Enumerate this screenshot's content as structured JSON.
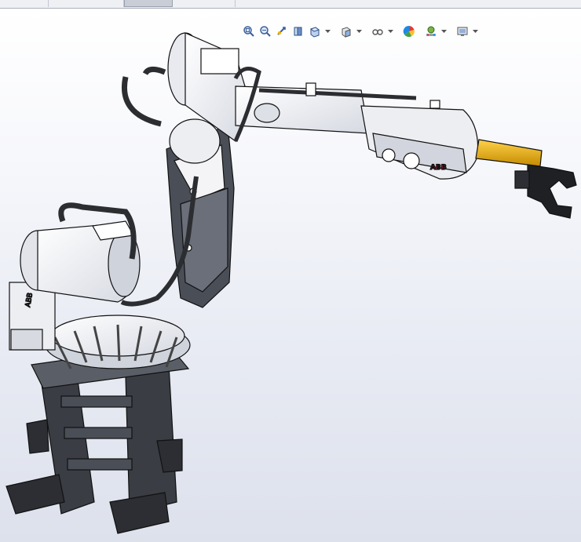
{
  "window": {
    "tabs": [
      {
        "name": "tab-1",
        "active": false
      },
      {
        "name": "tab-2",
        "active": false
      },
      {
        "name": "tab-3",
        "active": true
      },
      {
        "name": "tab-4",
        "active": false
      }
    ]
  },
  "toolbar": {
    "tools": [
      {
        "name": "zoom-to-fit-icon",
        "caret": false
      },
      {
        "name": "zoom-to-area-icon",
        "caret": false
      },
      {
        "name": "previous-view-icon",
        "caret": false
      },
      {
        "name": "section-view-icon",
        "caret": false
      },
      {
        "name": "view-orientation-icon",
        "caret": true
      },
      {
        "name": "display-style-icon",
        "caret": true
      },
      {
        "name": "hide-show-items-icon",
        "caret": true
      },
      {
        "name": "edit-appearance-icon",
        "caret": false
      },
      {
        "name": "apply-scene-icon",
        "caret": true
      },
      {
        "name": "view-settings-icon",
        "caret": true
      }
    ]
  },
  "model": {
    "brand_label": "ABB",
    "colors": {
      "body": "#f4f4f6",
      "outline": "#1a1a1a",
      "dark_link": "#4a4e57",
      "cable": "#2b2d31",
      "tool_yellow": "#e0a800",
      "pedestal": "#3a3d44",
      "brand_red": "#c8102e"
    }
  }
}
